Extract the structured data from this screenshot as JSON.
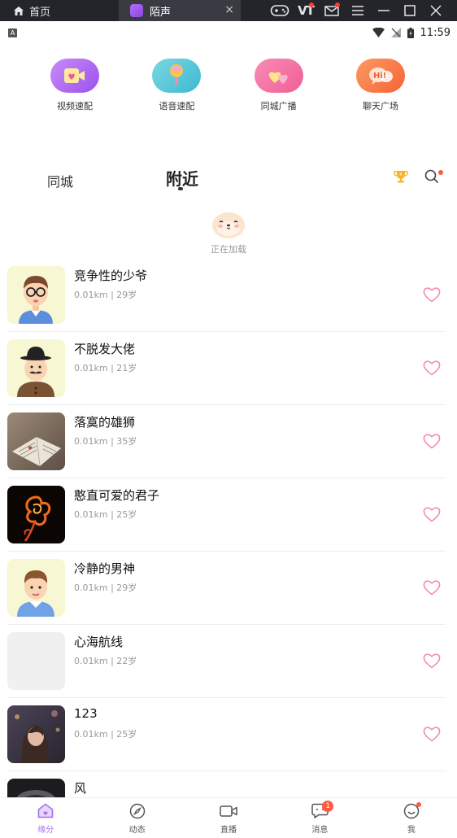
{
  "emulator": {
    "home_tab": "首页",
    "app_tab": "陌声",
    "tab_close": "×",
    "vt_label": "VT"
  },
  "status_bar": {
    "notif_letter": "A",
    "time": "11:59"
  },
  "features": [
    {
      "label": "视频速配",
      "icon": "video-heart-icon",
      "color": "#b46cf3"
    },
    {
      "label": "语音速配",
      "icon": "microphone-icon",
      "color": "#49c7d6"
    },
    {
      "label": "同城广播",
      "icon": "hearts-icon",
      "color": "#f47ba8"
    },
    {
      "label": "聊天广场",
      "icon": "chat-hi-icon",
      "color": "#fb7a4a"
    }
  ],
  "tabs": {
    "city": "同城",
    "nearby": "附近"
  },
  "loading_text": "正在加载",
  "users": [
    {
      "name": "竞争性的少爷",
      "meta": "0.01km | 29岁",
      "avatar": "cartoon-glasses"
    },
    {
      "name": "不脱发大佬",
      "meta": "0.01km | 21岁",
      "avatar": "cartoon-hat"
    },
    {
      "name": "落寞的雄狮",
      "meta": "0.01km | 35岁",
      "avatar": "photo-book"
    },
    {
      "name": "憨直可爱的君子",
      "meta": "0.01km | 25岁",
      "avatar": "photo-fire-rose"
    },
    {
      "name": "冷静的男神",
      "meta": "0.01km | 29岁",
      "avatar": "cartoon-boy"
    },
    {
      "name": "心海航线",
      "meta": "0.01km | 22岁",
      "avatar": "blank"
    },
    {
      "name": "123",
      "meta": "0.01km | 25岁",
      "avatar": "photo-girl"
    },
    {
      "name": "风",
      "meta": "",
      "avatar": "photo-dark"
    }
  ],
  "bottom_nav": [
    {
      "label": "缘分",
      "icon": "home-icon",
      "active": true
    },
    {
      "label": "动态",
      "icon": "compass-icon",
      "active": false
    },
    {
      "label": "直播",
      "icon": "video-camera-icon",
      "active": false
    },
    {
      "label": "消息",
      "icon": "message-icon",
      "badge": "1",
      "active": false
    },
    {
      "label": "我",
      "icon": "profile-icon",
      "active": false
    }
  ],
  "colors": {
    "accent": "#a56ef0",
    "heart": "#f28bb8",
    "badge": "#ff5a40"
  }
}
